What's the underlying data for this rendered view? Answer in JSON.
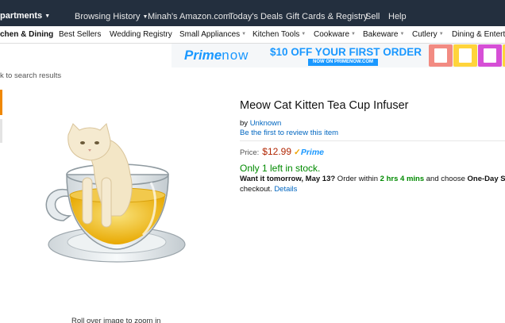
{
  "topnav": {
    "departments": "partments",
    "links": [
      "Browsing History",
      "Minah's Amazon.com",
      "Today's Deals",
      "Gift Cards & Registry",
      "Sell",
      "Help"
    ]
  },
  "subnav": {
    "items": [
      "chen & Dining",
      "Best Sellers",
      "Wedding Registry",
      "Small Appliances",
      "Kitchen Tools",
      "Cookware",
      "Bakeware",
      "Cutlery",
      "Dining & Enterta"
    ]
  },
  "banner": {
    "logo_prime": "Prime",
    "logo_now": "now",
    "offer": "$10 OFF YOUR FIRST ORDER",
    "offer_sub": "NOW ON PRIMENOW.COM",
    "colors": [
      "#f28b82",
      "#ffd43b",
      "#d64fd6",
      "#ffd43b"
    ]
  },
  "breadcrumb": "k to search results",
  "zoom_hint": "Roll over image to zoom in",
  "product": {
    "title": "Meow Cat Kitten Tea Cup Infuser",
    "by_label": "by",
    "brand": "Unknown",
    "review_link": "Be the first to review this item",
    "price_label": "Price:",
    "price": "$12.99",
    "prime_badge": "Prime",
    "stock": "Only 1 left in stock.",
    "delivery_want": "Want it tomorrow, May 13?",
    "delivery_order": " Order within ",
    "delivery_time": "2 hrs 4 mins",
    "delivery_choose": " and choose ",
    "delivery_option": "One-Day Sh",
    "delivery_checkout": "checkout.",
    "details_link": "Details"
  }
}
